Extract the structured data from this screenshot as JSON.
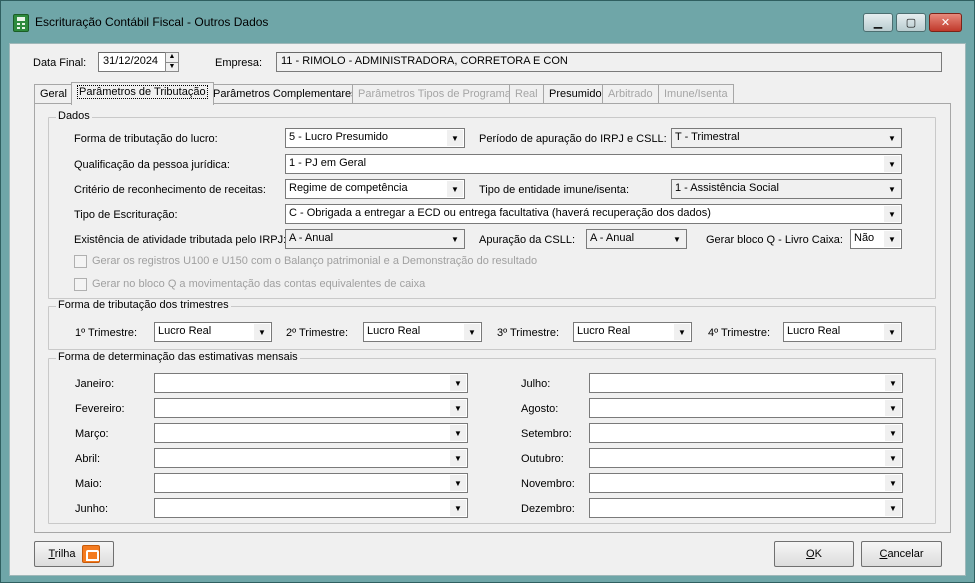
{
  "window": {
    "title": "Escrituração Contábil Fiscal - Outros Dados",
    "minimize": "▁",
    "maximize": "▢",
    "close": "✕"
  },
  "header": {
    "data_final_label": "Data Final:",
    "data_final_value": "31/12/2024",
    "empresa_label": "Empresa:",
    "empresa_value": "11 - RIMOLO - ADMINISTRADORA, CORRETORA E CON"
  },
  "tabs": [
    {
      "label": "Geral",
      "state": "normal"
    },
    {
      "label": "Parâmetros de Tributação",
      "state": "active"
    },
    {
      "label": "Parâmetros Complementares",
      "state": "normal"
    },
    {
      "label": "Parâmetros Tipos de Programa",
      "state": "disabled"
    },
    {
      "label": "Real",
      "state": "disabled"
    },
    {
      "label": "Presumido",
      "state": "normal"
    },
    {
      "label": "Arbitrado",
      "state": "disabled"
    },
    {
      "label": "Imune/Isenta",
      "state": "disabled"
    }
  ],
  "dados": {
    "legend": "Dados",
    "forma_tributacao_label": "Forma de tributação do lucro:",
    "forma_tributacao_value": "5 - Lucro Presumido",
    "periodo_apuracao_label": "Período de apuração do IRPJ e CSLL:",
    "periodo_apuracao_value": "T - Trimestral",
    "qualificacao_label": "Qualificação da pessoa jurídica:",
    "qualificacao_value": "1 - PJ em Geral",
    "criterio_label": "Critério de reconhecimento de receitas:",
    "criterio_value": "Regime de competência",
    "tipo_entidade_label": "Tipo de entidade imune/isenta:",
    "tipo_entidade_value": "1 - Assistência Social",
    "tipo_escrituracao_label": "Tipo de Escrituração:",
    "tipo_escrituracao_value": "C - Obrigada a entregar a ECD ou entrega facultativa (haverá recuperação dos dados)",
    "existencia_label": "Existência de atividade tributada pelo IRPJ:",
    "existencia_value": "A - Anual",
    "apuracao_csll_label": "Apuração da CSLL:",
    "apuracao_csll_value": "A - Anual",
    "bloco_q_label": "Gerar bloco Q - Livro Caixa:",
    "bloco_q_value": "Não",
    "check1_label": "Gerar os registros U100 e U150 com o Balanço patrimonial e a Demonstração do resultado",
    "check2_label": "Gerar no bloco Q a movimentação das contas equivalentes de caixa"
  },
  "trimestres": {
    "legend": "Forma de tributação dos trimestres",
    "items": [
      {
        "label": "1º Trimestre:",
        "value": "Lucro Real"
      },
      {
        "label": "2º Trimestre:",
        "value": "Lucro Real"
      },
      {
        "label": "3º Trimestre:",
        "value": "Lucro Real"
      },
      {
        "label": "4º Trimestre:",
        "value": "Lucro Real"
      }
    ]
  },
  "estimativas": {
    "legend": "Forma de determinação das estimativas mensais",
    "left": [
      {
        "label": "Janeiro:",
        "value": ""
      },
      {
        "label": "Fevereiro:",
        "value": ""
      },
      {
        "label": "Março:",
        "value": ""
      },
      {
        "label": "Abril:",
        "value": ""
      },
      {
        "label": "Maio:",
        "value": ""
      },
      {
        "label": "Junho:",
        "value": ""
      }
    ],
    "right": [
      {
        "label": "Julho:",
        "value": ""
      },
      {
        "label": "Agosto:",
        "value": ""
      },
      {
        "label": "Setembro:",
        "value": ""
      },
      {
        "label": "Outubro:",
        "value": ""
      },
      {
        "label": "Novembro:",
        "value": ""
      },
      {
        "label": "Dezembro:",
        "value": ""
      }
    ]
  },
  "footer": {
    "trilha_prefix": "T",
    "trilha_rest": "rilha",
    "ok_prefix": "O",
    "ok_rest": "K",
    "cancel_prefix": "C",
    "cancel_rest": "ancelar"
  }
}
